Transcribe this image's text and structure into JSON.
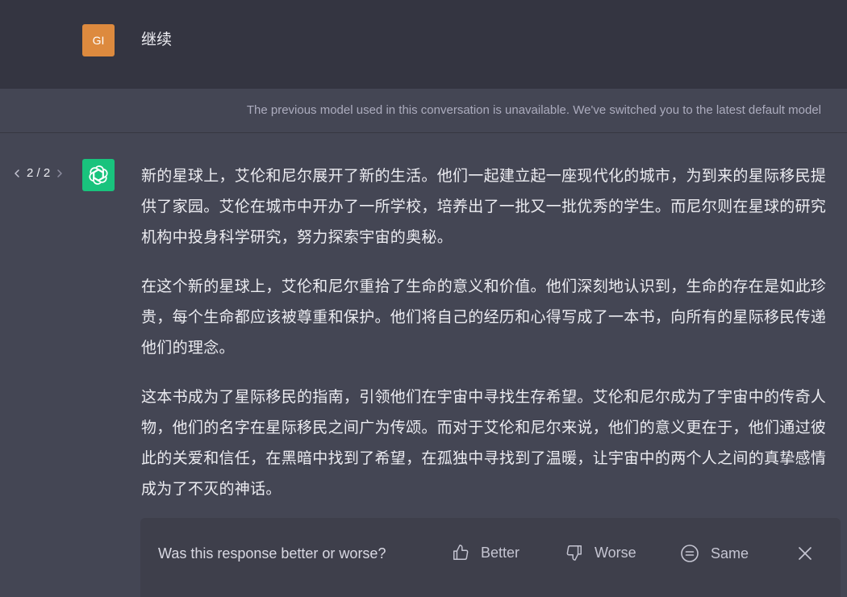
{
  "user": {
    "avatar_initials": "GI",
    "message": "继续"
  },
  "notice": {
    "text": "The previous model used in this conversation is unavailable. We've switched you to the latest default model"
  },
  "assistant": {
    "pager": "2 / 2",
    "paragraphs": [
      "新的星球上，艾伦和尼尔展开了新的生活。他们一起建立起一座现代化的城市，为到来的星际移民提供了家园。艾伦在城市中开办了一所学校，培养出了一批又一批优秀的学生。而尼尔则在星球的研究机构中投身科学研究，努力探索宇宙的奥秘。",
      "在这个新的星球上，艾伦和尼尔重拾了生命的意义和价值。他们深刻地认识到，生命的存在是如此珍贵，每个生命都应该被尊重和保护。他们将自己的经历和心得写成了一本书，向所有的星际移民传递他们的理念。",
      "这本书成为了星际移民的指南，引领他们在宇宙中寻找生存希望。艾伦和尼尔成为了宇宙中的传奇人物，他们的名字在星际移民之间广为传颂。而对于艾伦和尼尔来说，他们的意义更在于，他们通过彼此的关爱和信任，在黑暗中找到了希望，在孤独中寻找到了温暖，让宇宙中的两个人之间的真挚感情成为了不灭的神话。"
    ]
  },
  "feedback": {
    "question": "Was this response better or worse?",
    "better_label": "Better",
    "worse_label": "Worse",
    "same_label": "Same"
  },
  "colors": {
    "user_bg": "#343541",
    "assistant_bg": "#444654",
    "user_avatar": "#dd8a3e",
    "bot_avatar": "#19c37d"
  }
}
